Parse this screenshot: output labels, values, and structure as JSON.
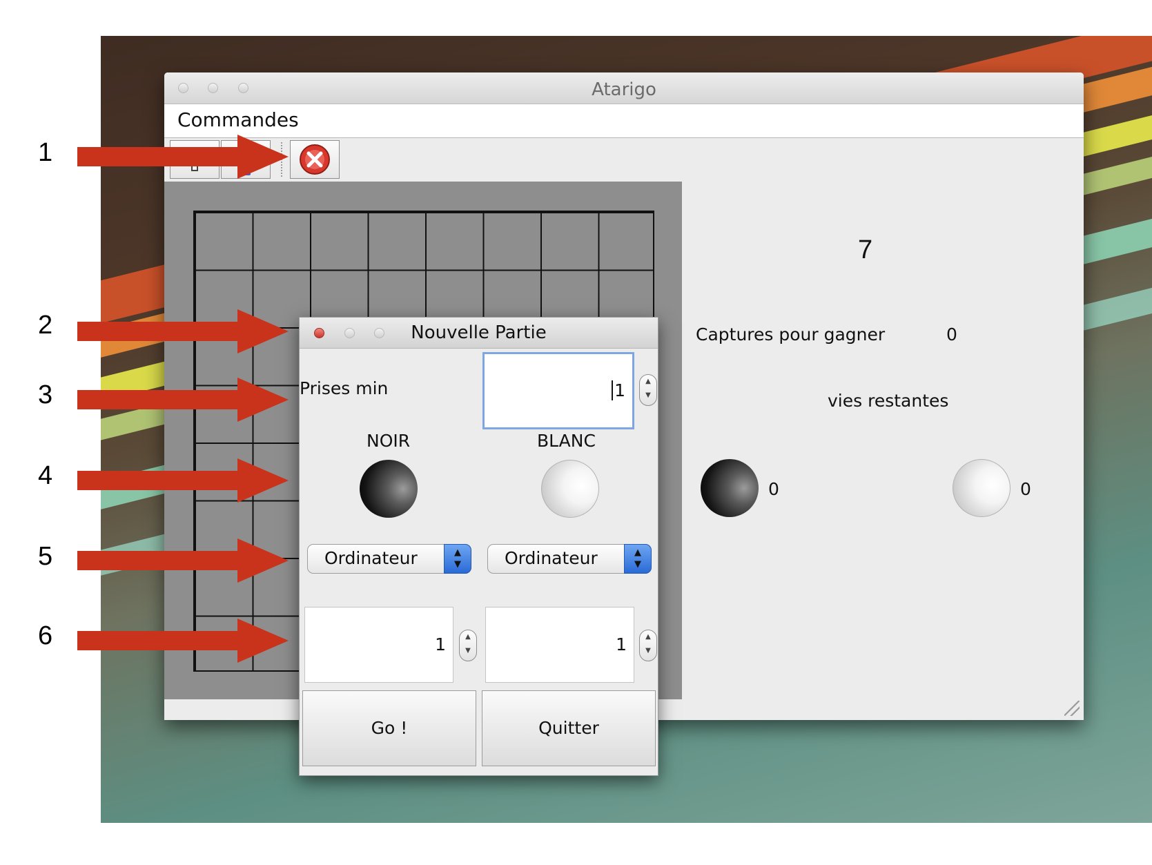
{
  "window": {
    "title": "Atarigo",
    "menu": [
      "Commandes"
    ]
  },
  "toolbar": {
    "buttons": [
      {
        "icon": "plus-icon"
      },
      {
        "icon": "lightbulb-icon"
      },
      {
        "icon": "quit-icon"
      }
    ]
  },
  "board": {
    "columns": 8,
    "rows": 8
  },
  "info_panel": {
    "count": "7",
    "captures_label": "Captures pour gagner",
    "captures_value": "0",
    "lives_label": "vies restantes",
    "black_lives": "0",
    "white_lives": "0"
  },
  "dialog": {
    "title": "Nouvelle Partie",
    "prises_label": "Prises min",
    "prises_value": "1",
    "black_label": "NOIR",
    "white_label": "BLANC",
    "black_player": "Ordinateur",
    "white_player": "Ordinateur",
    "black_level": "1",
    "white_level": "1",
    "go_label": "Go !",
    "quit_label": "Quitter"
  },
  "annotations": [
    "1",
    "2",
    "3",
    "4",
    "5",
    "6"
  ],
  "colors": {
    "arrow": "#c9321b",
    "selection": "#7ea6e0",
    "popup_accent": "#2a6ad6"
  }
}
